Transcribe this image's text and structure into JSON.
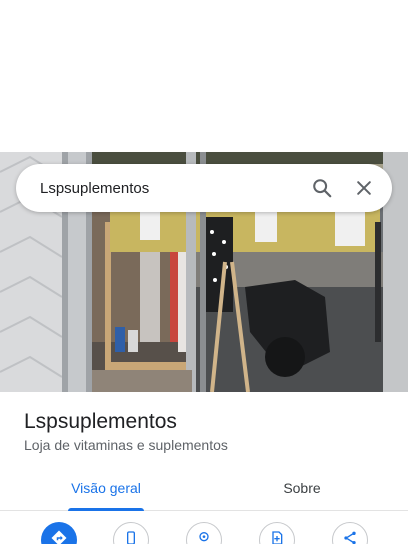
{
  "search": {
    "query": "Lspsuplementos"
  },
  "place": {
    "name": "Lspsuplementos",
    "category": "Loja de vitaminas e suplementos"
  },
  "tabs": [
    {
      "label": "Visão geral",
      "selected": true
    },
    {
      "label": "Sobre",
      "selected": false
    }
  ],
  "actions": [
    {
      "icon": "directions-icon",
      "style": "primary"
    },
    {
      "icon": "phone-icon",
      "style": "outline"
    },
    {
      "icon": "location-icon",
      "style": "outline"
    },
    {
      "icon": "save-icon",
      "style": "outline"
    },
    {
      "icon": "share-icon",
      "style": "outline"
    }
  ],
  "colors": {
    "accent": "#1a73e8",
    "title": "#202124",
    "secondary": "#5f6368"
  }
}
